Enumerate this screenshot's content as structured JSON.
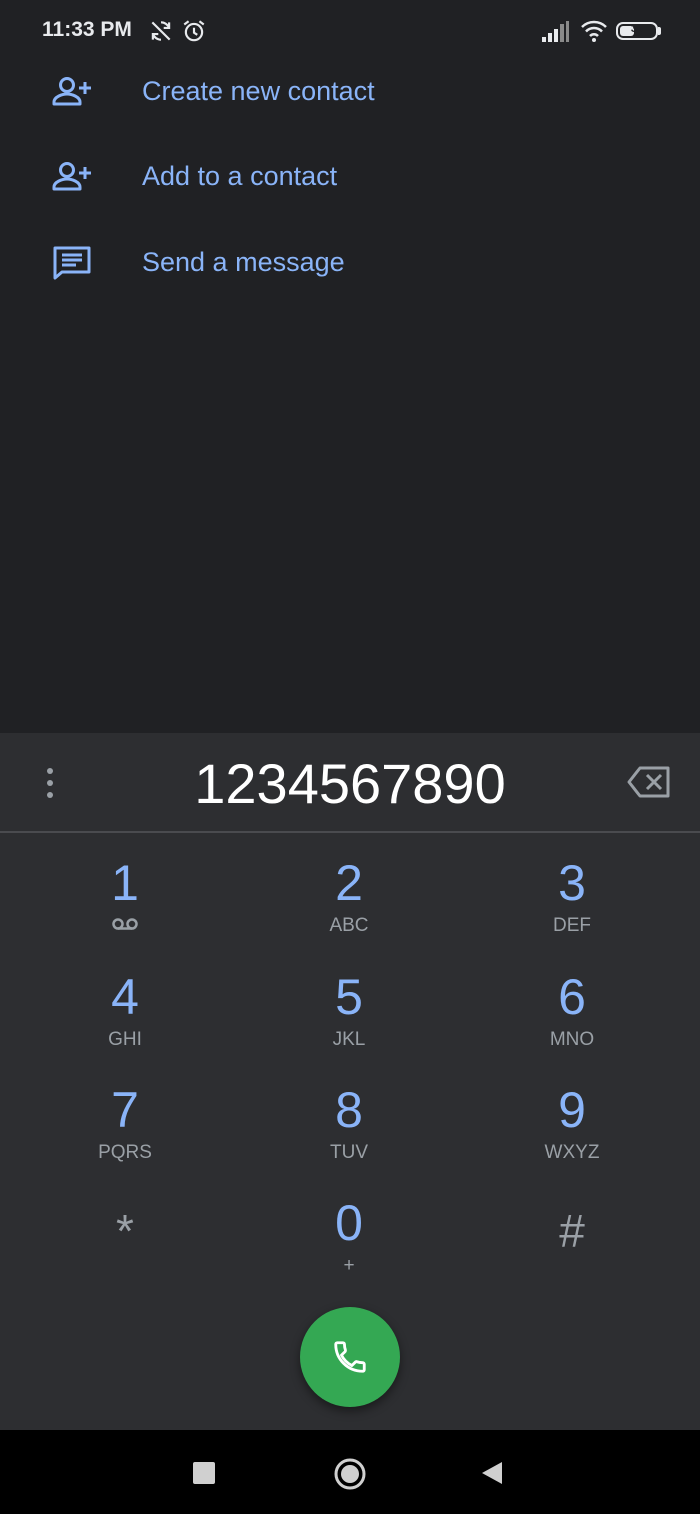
{
  "status_bar": {
    "time": "11:33 PM",
    "battery_level": "36",
    "icons": [
      "no-sync-icon",
      "alarm-icon",
      "signal-icon",
      "wifi-icon",
      "battery-icon"
    ]
  },
  "actions": [
    {
      "label": "Create new contact",
      "icon": "person-add-icon"
    },
    {
      "label": "Add to a contact",
      "icon": "person-add-icon"
    },
    {
      "label": "Send a message",
      "icon": "message-icon"
    }
  ],
  "dialer": {
    "digits": "1234567890",
    "keys": [
      {
        "digit": "1",
        "letters": ""
      },
      {
        "digit": "2",
        "letters": "ABC"
      },
      {
        "digit": "3",
        "letters": "DEF"
      },
      {
        "digit": "4",
        "letters": "GHI"
      },
      {
        "digit": "5",
        "letters": "JKL"
      },
      {
        "digit": "6",
        "letters": "MNO"
      },
      {
        "digit": "7",
        "letters": "PQRS"
      },
      {
        "digit": "8",
        "letters": "TUV"
      },
      {
        "digit": "9",
        "letters": "WXYZ"
      },
      {
        "digit": "*",
        "letters": ""
      },
      {
        "digit": "0",
        "letters": "+"
      },
      {
        "digit": "#",
        "letters": ""
      }
    ]
  },
  "colors": {
    "background": "#202124",
    "dialpad_background": "#2d2e31",
    "accent": "#8ab4f8",
    "call_button": "#34a853"
  }
}
